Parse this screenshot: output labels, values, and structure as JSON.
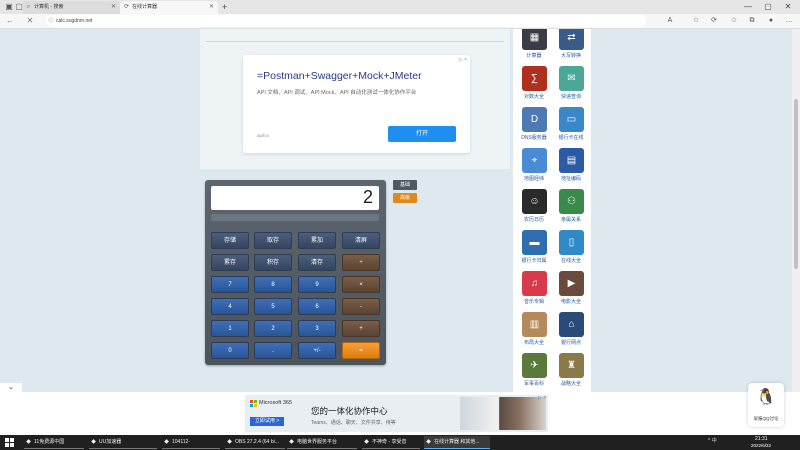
{
  "colors": {
    "accent": "#1f8ef1",
    "equals": "#e07c10",
    "calc_body": "#555e68",
    "page_bg": "#dde9ee"
  },
  "browser": {
    "tabs": [
      {
        "icon": "search-icon",
        "label": "计算机 - 搜索"
      },
      {
        "icon": "loading-icon",
        "label": "在线计算器"
      }
    ],
    "url": "calc.sugdnm.net"
  },
  "ad_card": {
    "title": "=Postman+Swagger+Mock+JMeter",
    "description": "API 文档、API 调试、API Mock、API 自动化测试一体化协作平台",
    "domain": "apifox",
    "button": "打开",
    "badge": "▷ ×"
  },
  "calculator": {
    "display": "2",
    "mode_buttons": {
      "basic": "基础",
      "advanced": "高级"
    },
    "memory": [
      "存储",
      "取存",
      "累加",
      "清屏"
    ],
    "row2": [
      "累存",
      "积存",
      "清存",
      "÷"
    ],
    "row3": [
      "7",
      "8",
      "9",
      "×"
    ],
    "row4": [
      "4",
      "5",
      "6",
      "-"
    ],
    "row5": [
      "1",
      "2",
      "3",
      "+"
    ],
    "row6": [
      "0",
      ".",
      "+/-",
      "="
    ]
  },
  "apps": [
    {
      "label": "计算器",
      "icon": "calc-icon",
      "color": "#3c3c46"
    },
    {
      "label": "大写转换",
      "icon": "convert-icon",
      "color": "#3a5a8a"
    },
    {
      "label": "对数大全",
      "icon": "log-icon",
      "color": "#b03020"
    },
    {
      "label": "快递查询",
      "icon": "express-icon",
      "color": "#4aa896"
    },
    {
      "label": "DNS服务器",
      "icon": "dns-icon",
      "color": "#4d7ab5"
    },
    {
      "label": "银行卡在线",
      "icon": "card-icon",
      "color": "#3a88c8"
    },
    {
      "label": "地图经纬",
      "icon": "map-icon",
      "color": "#4b8bd6"
    },
    {
      "label": "地址编码",
      "icon": "doc-icon",
      "color": "#2b5aa6"
    },
    {
      "label": "农历日历",
      "icon": "person-icon",
      "color": "#2a2a2a"
    },
    {
      "label": "亲属关系",
      "icon": "family-icon",
      "color": "#3a8a4a"
    },
    {
      "label": "银行卡归属",
      "icon": "bank-card-icon",
      "color": "#2f6fb0"
    },
    {
      "label": "在线大全",
      "icon": "book-icon",
      "color": "#2f8ac6"
    },
    {
      "label": "音乐专辑",
      "icon": "music-icon",
      "color": "#d83a4a"
    },
    {
      "label": "电影大全",
      "icon": "movie-icon",
      "color": "#6a4a3a"
    },
    {
      "label": "布局大全",
      "icon": "grid-icon",
      "color": "#b58a5a"
    },
    {
      "label": "银行网点",
      "icon": "bank-icon",
      "color": "#2a4a7a"
    },
    {
      "label": "军事百科",
      "icon": "plane-icon",
      "color": "#5a7a3a"
    },
    {
      "label": "战略大全",
      "icon": "strategy-icon",
      "color": "#8a7a4a"
    }
  ],
  "banner": {
    "brand": "Microsoft 365",
    "cta": "立即试用 >",
    "slogan": "您的一体化协作中心",
    "sub": "Teams、通话、聊天、文件共享、待等",
    "choice": "▷ ×"
  },
  "qq": {
    "label": "早报QQ讨论"
  },
  "taskbar": {
    "items": [
      {
        "label": "11免费源中国",
        "icon": "app-icon"
      },
      {
        "label": "UU加速器",
        "icon": "uu-icon"
      },
      {
        "label": "104112-",
        "icon": "app-icon"
      },
      {
        "label": "OBS 27.2.4 (64 bi...",
        "icon": "obs-icon"
      },
      {
        "label": "电脑世界服务平台",
        "icon": "app-icon"
      },
      {
        "label": "不神奇 - 享受音",
        "icon": "app-icon"
      },
      {
        "label": "在线计算器 和其他...",
        "icon": "edge-icon"
      }
    ],
    "tray": "^ 中",
    "time": "21:31",
    "date": "2022/6/22"
  }
}
